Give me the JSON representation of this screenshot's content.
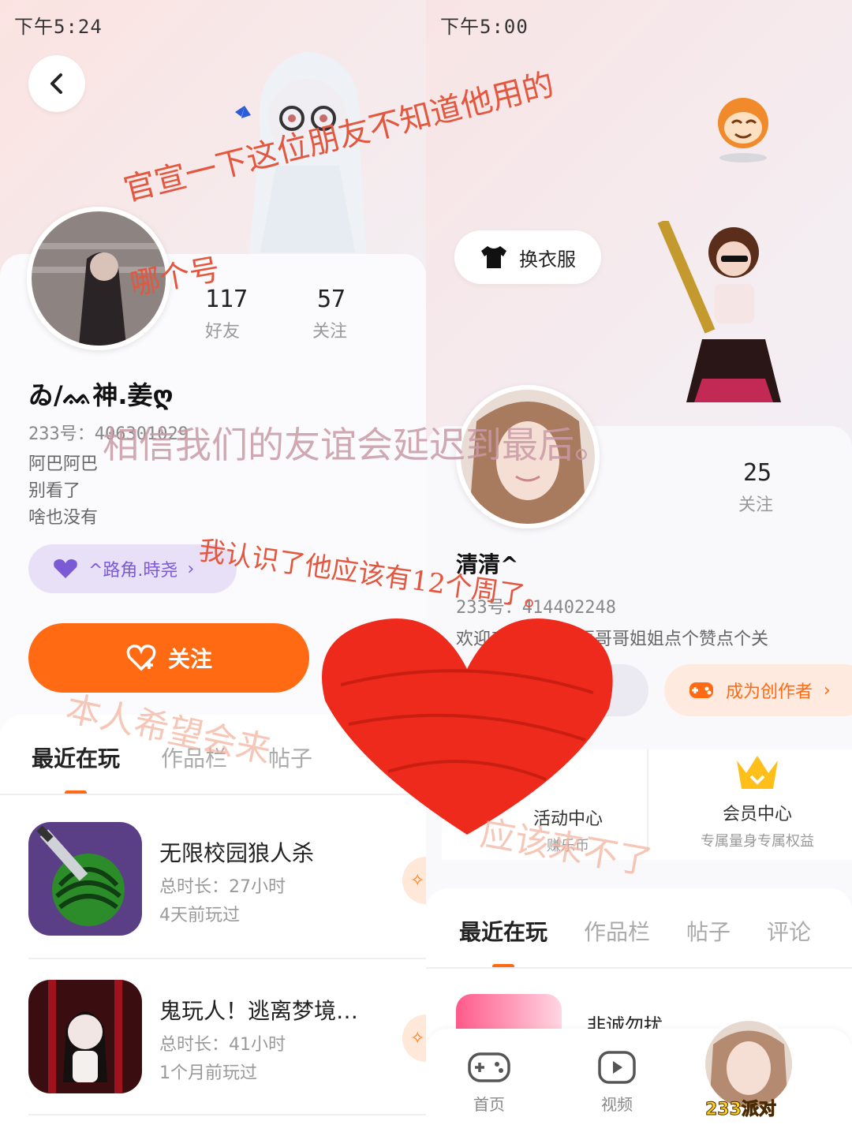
{
  "left": {
    "status_time": "下午5:24",
    "stats": [
      {
        "value": "117",
        "label": "好友"
      },
      {
        "value": "57",
        "label": "关注"
      }
    ],
    "name": "ゐ/ᨐ神.姜ღ",
    "uid": "233号：406301029",
    "bio": [
      "阿巴阿巴",
      "别看了",
      "啥也没有"
    ],
    "friend_pill": "^路角.時尧",
    "follow_button": "关注",
    "tabs": [
      "最近在玩",
      "作品栏",
      "帖子"
    ],
    "games": [
      {
        "title": "无限校园狼人杀",
        "duration": "总时长：27小时",
        "last_played": "4天前玩过"
      },
      {
        "title": "鬼玩人！逃离梦境…",
        "duration": "总时长：41小时",
        "last_played": "1个月前玩过"
      }
    ]
  },
  "right": {
    "status_time": "下午5:00",
    "dress_button": "换衣服",
    "stats": [
      {
        "value": "25",
        "label": "关注"
      }
    ],
    "name": "清清^",
    "uid": "233号：414402248",
    "bio": "欢迎来到我的主页哥哥姐姐点个赞点个关",
    "creator_pill": "成为创作者",
    "centers": [
      {
        "title": "活动中心",
        "subtitle": "赚乐币"
      },
      {
        "title": "会员中心",
        "subtitle": "专属量身专属权益"
      }
    ],
    "tabs": [
      "最近在玩",
      "作品栏",
      "帖子",
      "评论"
    ],
    "game_title": "非诚勿扰",
    "nav": [
      {
        "label": "首页",
        "icon": "gamepad-icon"
      },
      {
        "label": "视频",
        "icon": "video-icon"
      }
    ],
    "party_badge": "233派对"
  },
  "annotations": [
    "官宣一下这位朋友不知道他用的",
    "哪个号",
    "相信我们的友谊会延迟到最后。",
    "我认识了他应该有12个周了。",
    "本人希望会来",
    "应该来不了"
  ],
  "colors": {
    "accent": "#ff6a13",
    "annotation": "#e4573f",
    "heart": "#ee2a1c"
  }
}
